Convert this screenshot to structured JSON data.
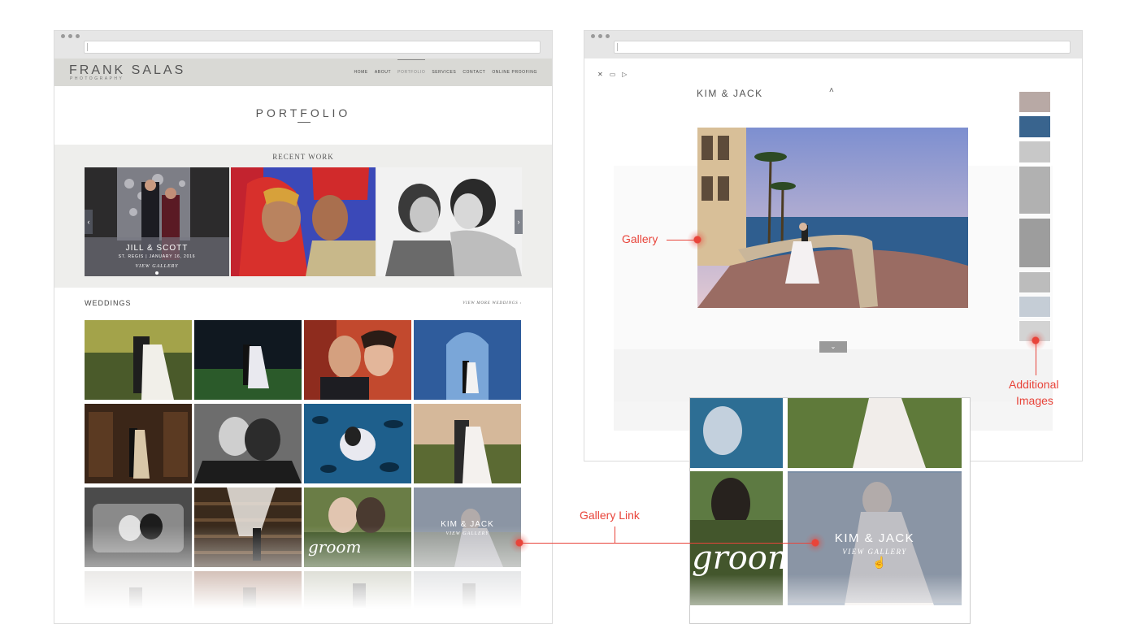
{
  "site": {
    "brand": "FRANK SALAS",
    "brand_sub": "PHOTOGRAPHY",
    "nav": [
      "HOME",
      "ABOUT",
      "PORTFOLIO",
      "SERVICES",
      "CONTACT",
      "ONLINE PROOFING"
    ],
    "active_nav": "PORTFOLIO",
    "page_title": "PORTFOLIO",
    "recent_label": "RECENT WORK",
    "featured": {
      "title": "JILL & SCOTT",
      "subtitle": "ST. REGIS  |  JANUARY 16, 2016",
      "link": "VIEW GALLERY"
    },
    "weddings_heading": "WEDDINGS",
    "weddings_link": "VIEW MORE WEDDINGS  ›",
    "hover_tile": {
      "title": "KIM & JACK",
      "link": "VIEW GALLERY"
    }
  },
  "lightbox": {
    "title": "KIM & JACK",
    "tools": [
      "✕",
      "▭",
      "▷"
    ]
  },
  "zoom": {
    "title": "KIM & JACK",
    "link": "VIEW GALLERY"
  },
  "annotations": {
    "gallery": "Gallery",
    "additional": "Additional",
    "additional2": "Images",
    "gallery_link": "Gallery Link"
  },
  "colors": {
    "accent": "#e8443a",
    "header": "#d9d9d5",
    "band": "#eeeeec"
  }
}
